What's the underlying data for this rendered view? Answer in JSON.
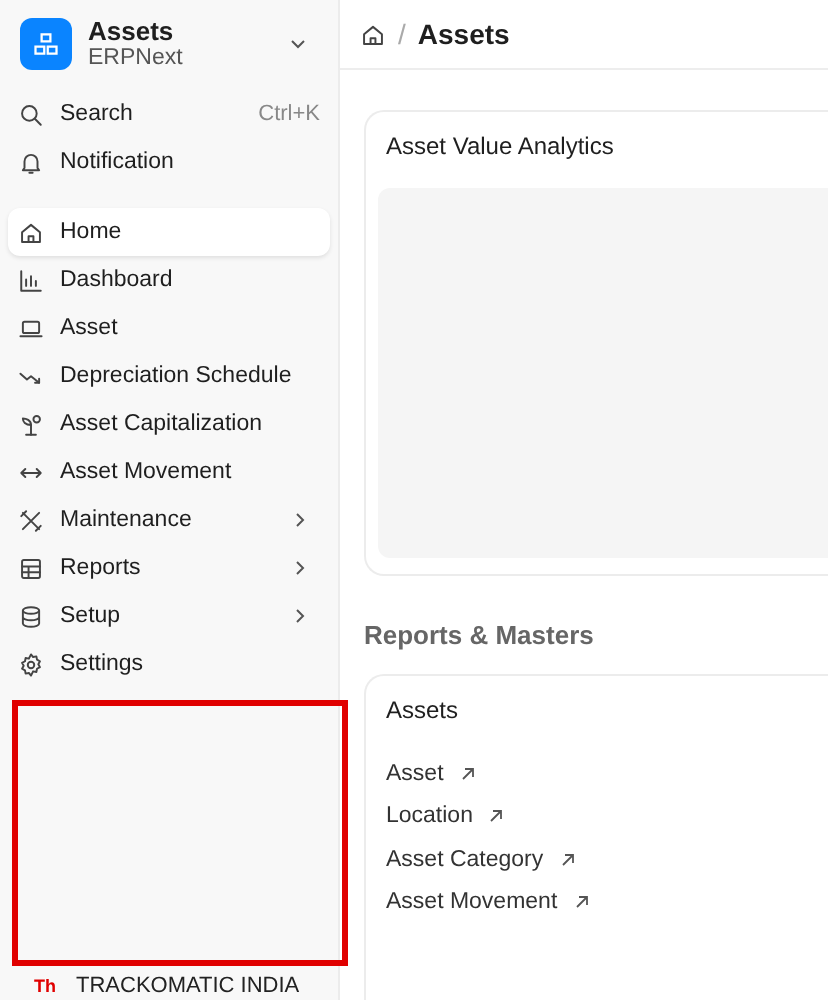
{
  "sidebar": {
    "app": {
      "title": "Assets",
      "subtitle": "ERPNext"
    },
    "utilities": [
      {
        "label": "Search",
        "shortcut": "Ctrl+K"
      },
      {
        "label": "Notification"
      }
    ],
    "items": [
      {
        "label": "Home",
        "selected": true,
        "submenu": false
      },
      {
        "label": "Dashboard",
        "selected": false,
        "submenu": false
      },
      {
        "label": "Asset",
        "selected": false,
        "submenu": false
      },
      {
        "label": "Depreciation Schedule",
        "selected": false,
        "submenu": false
      },
      {
        "label": "Asset Capitalization",
        "selected": false,
        "submenu": false
      },
      {
        "label": "Asset Movement",
        "selected": false,
        "submenu": false
      },
      {
        "label": "Maintenance",
        "selected": false,
        "submenu": true
      },
      {
        "label": "Reports",
        "selected": false,
        "submenu": true
      },
      {
        "label": "Setup",
        "selected": false,
        "submenu": true
      },
      {
        "label": "Settings",
        "selected": false,
        "submenu": false
      }
    ]
  },
  "breadcrumb": {
    "separator": "/",
    "current": "Assets"
  },
  "chart_card": {
    "title": "Asset Value Analytics"
  },
  "section_title": "Reports & Masters",
  "reports_card": {
    "title": "Assets",
    "links": [
      "Asset",
      "Location",
      "Asset Category",
      "Asset Movement"
    ]
  },
  "annotation": {
    "caption": "TRACKOMATIC INDIA",
    "cut_text": "Th"
  }
}
